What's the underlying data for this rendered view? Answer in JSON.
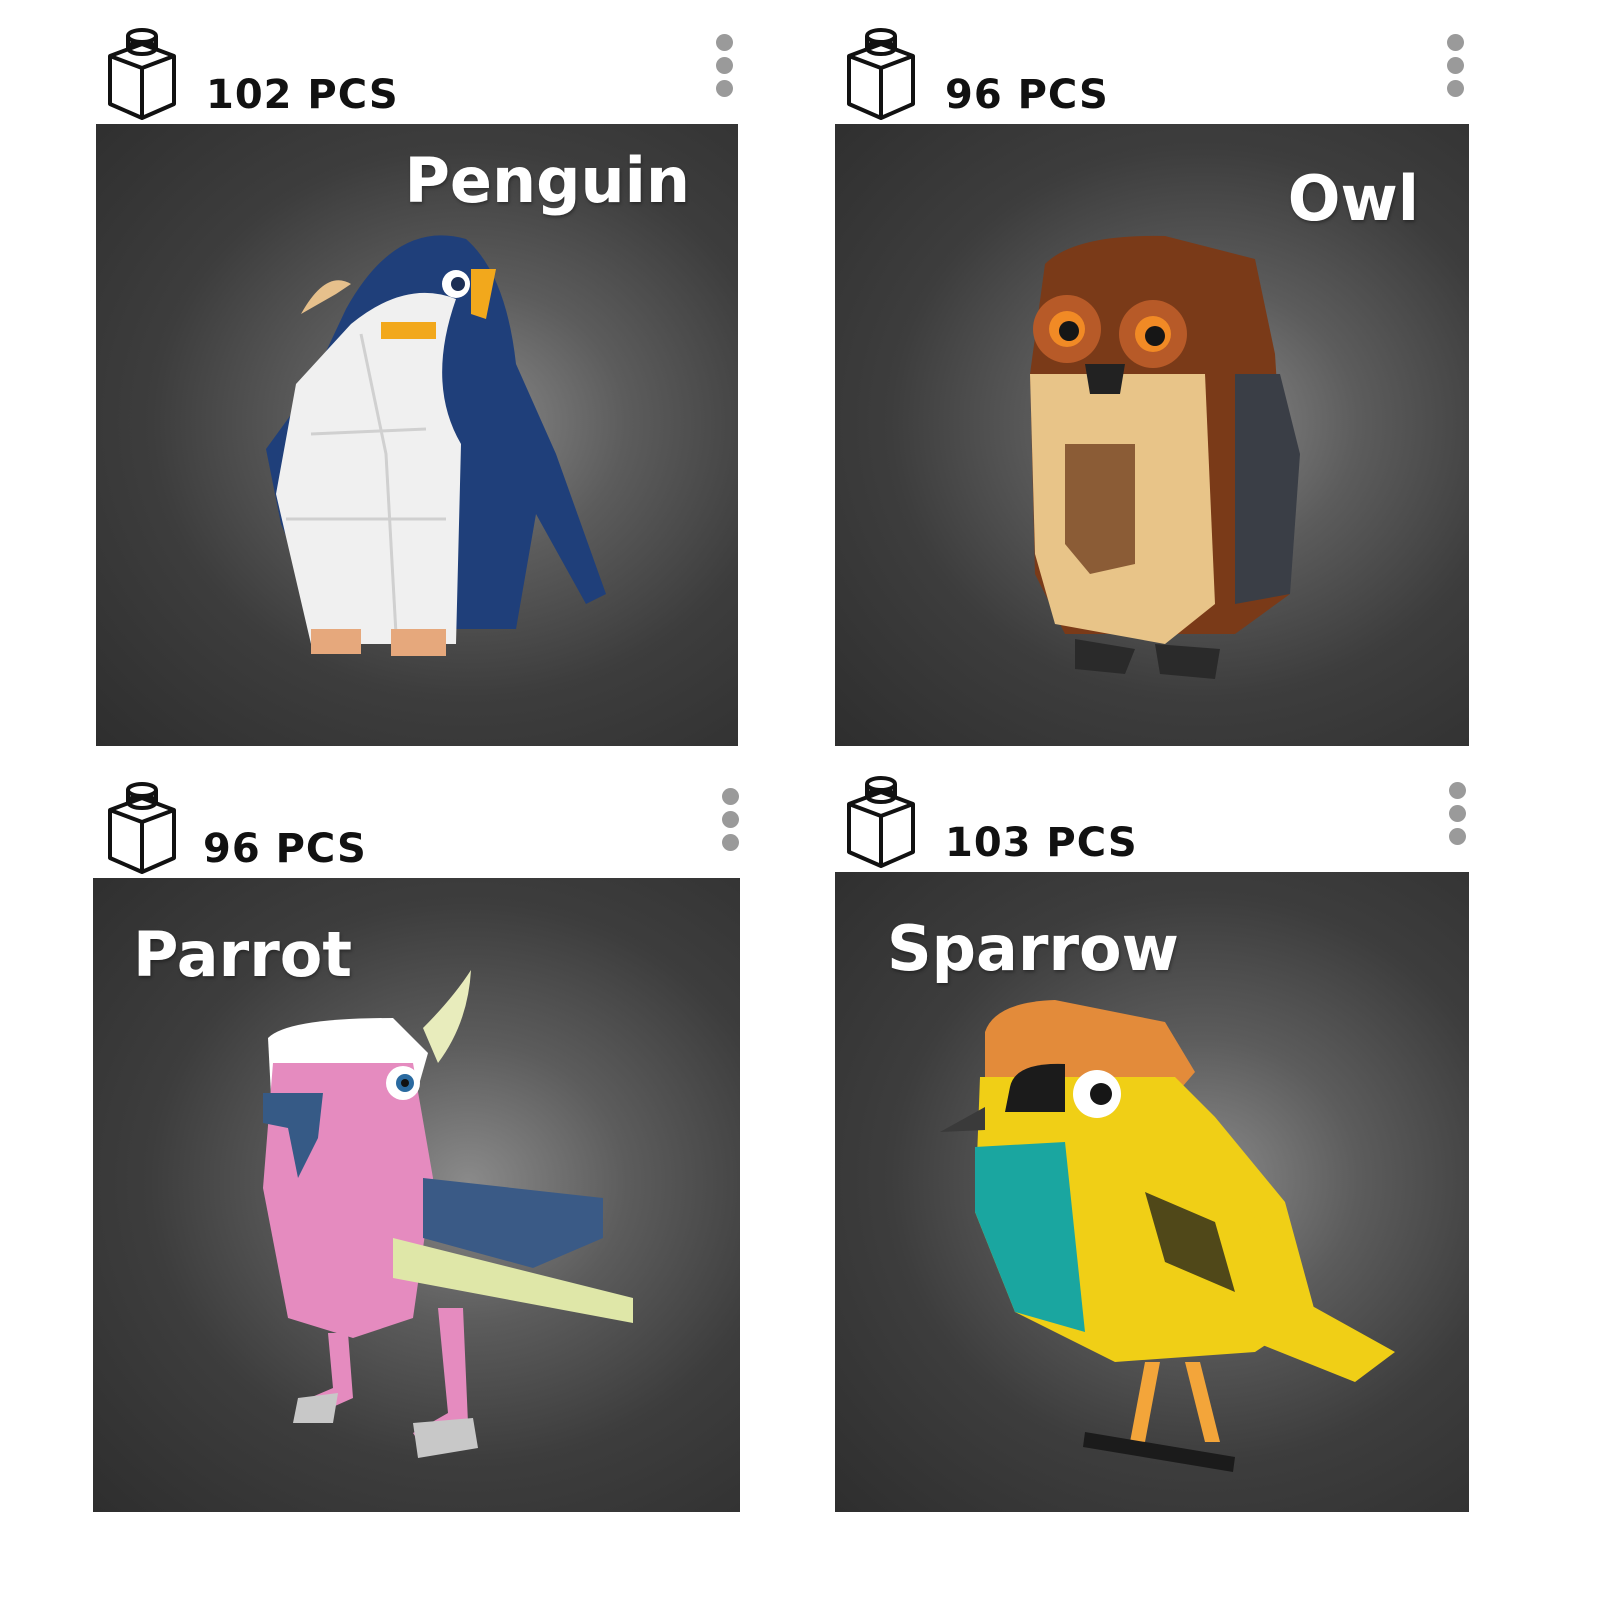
{
  "cards": [
    {
      "pieces": "102 PCS",
      "name": "Penguin",
      "image_icon": "lego-penguin-image"
    },
    {
      "pieces": "96 PCS",
      "name": "Owl",
      "image_icon": "lego-owl-image"
    },
    {
      "pieces": "96 PCS",
      "name": "Parrot",
      "image_icon": "lego-parrot-image"
    },
    {
      "pieces": "103 PCS",
      "name": "Sparrow",
      "image_icon": "lego-sparrow-image"
    }
  ],
  "icons": {
    "header": "brick-icon",
    "menu": "more-vertical-icon"
  }
}
